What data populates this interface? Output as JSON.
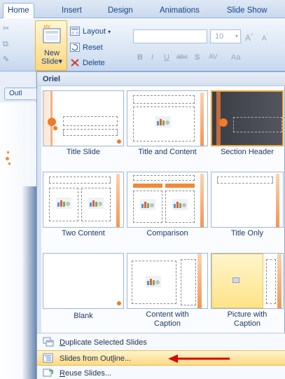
{
  "ribbon_tabs": [
    "Home",
    "Insert",
    "Design",
    "Animations",
    "Slide Show"
  ],
  "active_tab": "Home",
  "clipboard_stub": [
    "",
    "",
    "",
    "d"
  ],
  "new_slide": {
    "label_line1": "New",
    "label_line2": "Slide",
    "dropdown_glyph": "▾"
  },
  "slides_group": {
    "layout_label": "Layout",
    "reset_label": "Reset",
    "delete_label": "Delete"
  },
  "font": {
    "size_value": "10",
    "bold": "B",
    "italic": "I",
    "underline": "U",
    "strike": "abc",
    "shadow": "S",
    "spacing": "AV",
    "case": "Aa",
    "grow": "A",
    "shrink": "A"
  },
  "left_pane": {
    "outline_tab": "Outl"
  },
  "gallery": {
    "theme_name": "Oriel",
    "layouts": [
      {
        "name": "Title Slide"
      },
      {
        "name": "Title and Content"
      },
      {
        "name": "Section Header"
      },
      {
        "name": "Two Content"
      },
      {
        "name": "Comparison"
      },
      {
        "name": "Title Only"
      },
      {
        "name": "Blank"
      },
      {
        "name": "Content with\nCaption"
      },
      {
        "name": "Picture with\nCaption"
      }
    ]
  },
  "menu": {
    "duplicate": {
      "pre": "",
      "ul": "D",
      "post": "uplicate Selected Slides"
    },
    "outline": {
      "pre": "Slides from Out",
      "ul": "l",
      "post": "ine..."
    },
    "reuse": {
      "pre": "",
      "ul": "R",
      "post": "euse Slides..."
    }
  },
  "colors": {
    "accent_orange": "#ef7a28",
    "ribbon_blue": "#15428b",
    "highlight_arrow": "#d10a0a"
  }
}
